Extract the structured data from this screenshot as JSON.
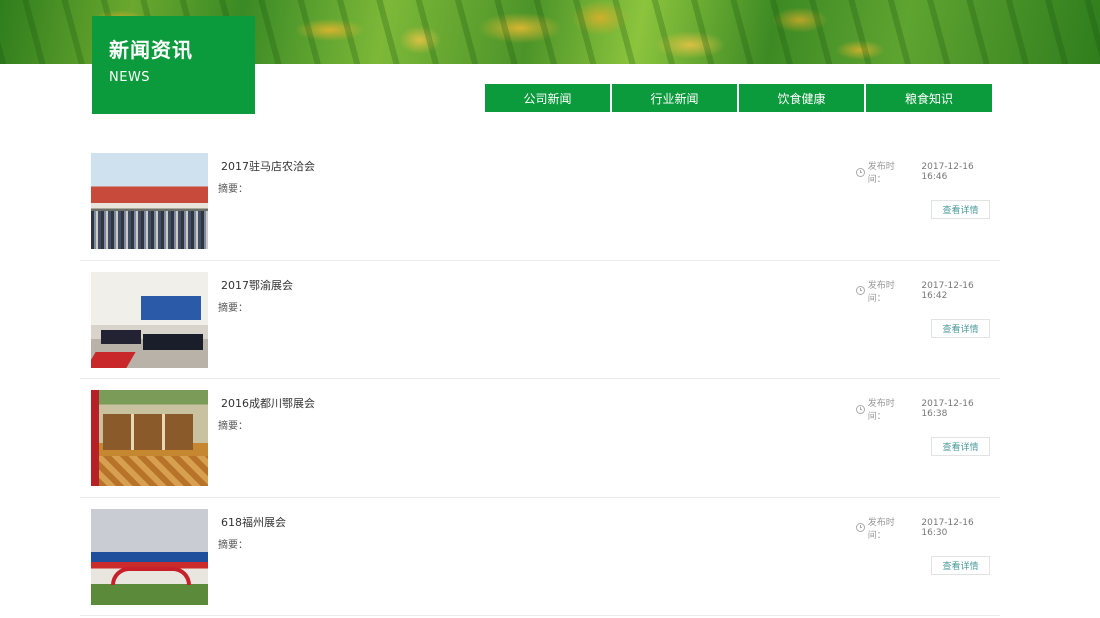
{
  "header": {
    "title_cn": "新闻资讯",
    "title_en": "NEWS"
  },
  "tabs": [
    {
      "label": "公司新闻"
    },
    {
      "label": "行业新闻"
    },
    {
      "label": "饮食健康"
    },
    {
      "label": "粮食知识"
    }
  ],
  "news": [
    {
      "title": "2017驻马店农洽会",
      "summary_label": "摘要：",
      "time_label": "发布时间：",
      "time": "2017-12-16 16:46",
      "button": "查看详情"
    },
    {
      "title": "2017鄂渝展会",
      "summary_label": "摘要：",
      "time_label": "发布时间：",
      "time": "2017-12-16 16:42",
      "button": "查看详情"
    },
    {
      "title": "2016成都川鄂展会",
      "summary_label": "摘要：",
      "time_label": "发布时间：",
      "time": "2017-12-16 16:38",
      "button": "查看详情"
    },
    {
      "title": "618福州展会",
      "summary_label": "摘要：",
      "time_label": "发布时间：",
      "time": "2017-12-16 16:30",
      "button": "查看详情"
    }
  ],
  "colors": {
    "brand_green": "#0b9a3c",
    "button_text": "#4a9a9a"
  }
}
